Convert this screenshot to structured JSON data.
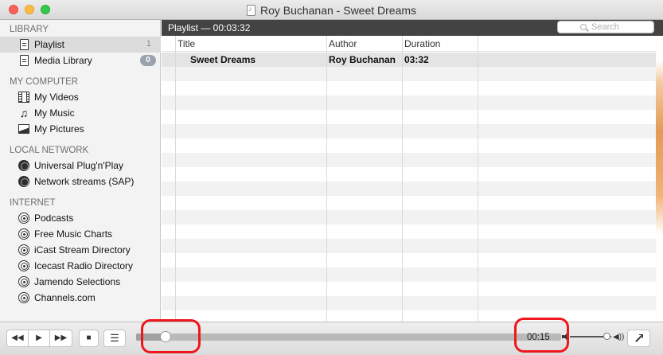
{
  "window": {
    "title": "Roy Buchanan - Sweet Dreams"
  },
  "sidebar": {
    "sections": [
      {
        "heading": "LIBRARY",
        "items": [
          {
            "label": "Playlist",
            "icon": "playlist-doc-icon",
            "count": "1"
          },
          {
            "label": "Media Library",
            "icon": "media-library-doc-icon",
            "badge": "0"
          }
        ]
      },
      {
        "heading": "MY COMPUTER",
        "items": [
          {
            "label": "My Videos",
            "icon": "film-icon"
          },
          {
            "label": "My Music",
            "icon": "music-note-icon"
          },
          {
            "label": "My Pictures",
            "icon": "picture-icon"
          }
        ]
      },
      {
        "heading": "LOCAL NETWORK",
        "items": [
          {
            "label": "Universal Plug'n'Play",
            "icon": "globe-icon"
          },
          {
            "label": "Network streams (SAP)",
            "icon": "globe-icon"
          }
        ]
      },
      {
        "heading": "INTERNET",
        "items": [
          {
            "label": "Podcasts",
            "icon": "podcast-icon"
          },
          {
            "label": "Free Music Charts",
            "icon": "podcast-icon"
          },
          {
            "label": "iCast Stream Directory",
            "icon": "podcast-icon"
          },
          {
            "label": "Icecast Radio Directory",
            "icon": "podcast-icon"
          },
          {
            "label": "Jamendo Selections",
            "icon": "podcast-icon"
          },
          {
            "label": "Channels.com",
            "icon": "podcast-icon"
          }
        ]
      }
    ]
  },
  "playlist": {
    "header": "Playlist — 00:03:32",
    "search_placeholder": "Search",
    "columns": [
      "Title",
      "Author",
      "Duration"
    ],
    "rows": [
      {
        "title": "Sweet Dreams",
        "author": "Roy Buchanan",
        "duration": "03:32"
      }
    ]
  },
  "controls": {
    "time": "00:15",
    "progress_fraction": 0.07,
    "volume_fraction": 0.88,
    "rewind_glyph": "◀◀",
    "play_glyph": "▶",
    "forward_glyph": "▶▶",
    "stop_glyph": "■",
    "playlist_glyph": "☰",
    "volume_high_glyph": "◀))"
  },
  "colors": {
    "annotation": "#f0161c",
    "header_bg": "#434343"
  }
}
